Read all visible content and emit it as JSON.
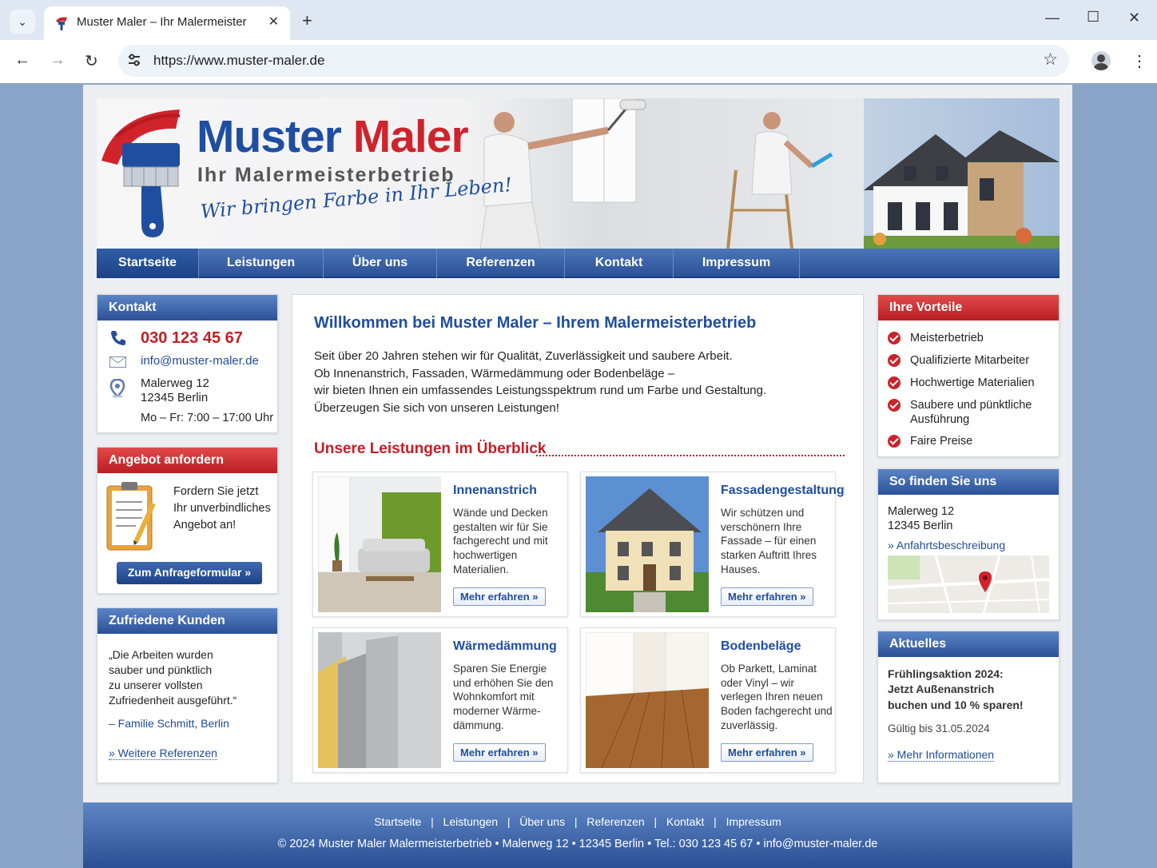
{
  "browser": {
    "tab_title": "Muster Maler – Ihr Malermeister",
    "url": "https://www.muster-maler.de"
  },
  "header": {
    "logo_word1": "Muster",
    "logo_word2": "Maler",
    "logo_sub": "Ihr Malermeisterbetrieb",
    "slogan": "Wir bringen Farbe in Ihr Leben!"
  },
  "nav": [
    "Startseite",
    "Leistungen",
    "Über uns",
    "Referenzen",
    "Kontakt",
    "Impressum"
  ],
  "contact": {
    "title": "Kontakt",
    "phone": "030 123 45 67",
    "email": "info@muster-maler.de",
    "street": "Malerweg 12",
    "city": "12345 Berlin",
    "hours": "Mo – Fr: 7:00 – 17:00 Uhr"
  },
  "offer": {
    "title": "Angebot anfordern",
    "lines": [
      "Fordern Sie jetzt",
      "Ihr unverbindliches",
      "Angebot an!"
    ],
    "button": "Zum Anfrageformular »"
  },
  "testimonial": {
    "title": "Zufriedene Kunden",
    "lines": [
      "„Die Arbeiten wurden",
      "sauber und pünktlich",
      "zu unserer vollsten",
      "Zufriedenheit ausgeführt.“"
    ],
    "author": "– Familie Schmitt, Berlin",
    "link": "» Weitere Referenzen"
  },
  "main": {
    "title": "Willkommen bei Muster Maler – Ihrem  Malermeisterbetrieb",
    "paragraph": [
      "Seit über 20 Jahren stehen wir für Qualität, Zuverlässigkeit und saubere Arbeit.",
      "Ob Innenanstrich, Fassaden, Wärmedämmung oder Bodenbeläge –",
      "wir bieten Ihnen ein umfassendes Leistungsspektrum rund um Farbe und Gestaltung.",
      "Überzeugen Sie sich von unseren Leistungen!"
    ],
    "services_title": "Unsere Leistungen im Überblick",
    "services": [
      {
        "title": "Innenanstrich",
        "text": "Wände und Decken gestalten wir für Sie fachgerecht und mit hochwertigen Materialien.",
        "button": "Mehr erfahren  »"
      },
      {
        "title": "Fassadengestaltung",
        "text": "Wir schützen und verschönern Ihre Fassade – für einen starken Auftritt Ihres Hauses.",
        "button": "Mehr erfahren  »"
      },
      {
        "title": "Wärmedämmung",
        "text": "Sparen Sie Energie und erhöhen Sie den Wohnkomfort mit moderner Wärme-dämmung.",
        "button": "Mehr erfahren  »"
      },
      {
        "title": "Bodenbeläge",
        "text": "Ob Parkett, Laminat oder Vinyl – wir verlegen Ihren neuen Boden fachgerecht und zuverlässig.",
        "button": "Mehr erfahren  »"
      }
    ]
  },
  "advantages": {
    "title": "Ihre Vorteile",
    "items": [
      "Meisterbetrieb",
      "Qualifizierte Mitarbeiter",
      "Hochwertige Materialien",
      "Saubere und pünktliche Ausführung",
      "Faire Preise"
    ]
  },
  "location": {
    "title": "So finden Sie uns",
    "street": "Malerweg 12",
    "city": "12345 Berlin",
    "link": "» Anfahrtsbeschreibung"
  },
  "news": {
    "title": "Aktuelles",
    "lines": [
      "Frühlingsaktion 2024:",
      "Jetzt Außenanstrich",
      "buchen und 10 % sparen!"
    ],
    "valid": "Gültig bis 31.05.2024",
    "link": "» Mehr Informationen"
  },
  "footer": {
    "links": [
      "Startseite",
      "Leistungen",
      "Über uns",
      "Referenzen",
      "Kontakt",
      "Impressum"
    ],
    "copyright": "© 2024 Muster Maler Malermeisterbetrieb  •  Malerweg 12  •  12345 Berlin  •  Tel.: 030 123 45 67  •  info@muster-maler.de"
  },
  "colors": {
    "brand_blue": "#1f4ea1",
    "brand_red": "#c41e24"
  }
}
